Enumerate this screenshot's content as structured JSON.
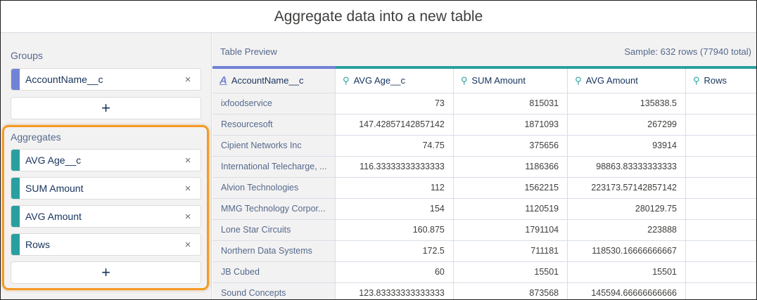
{
  "header": {
    "title": "Aggregate data into a new table"
  },
  "left": {
    "groups_label": "Groups",
    "groups": [
      {
        "label": "AccountName__c"
      }
    ],
    "aggregates_label": "Aggregates",
    "aggregates": [
      {
        "label": "AVG Age__c"
      },
      {
        "label": "SUM Amount"
      },
      {
        "label": "AVG Amount"
      },
      {
        "label": "Rows"
      }
    ],
    "add_symbol": "+",
    "remove_symbol": "×"
  },
  "preview": {
    "title": "Table Preview",
    "sample": "Sample: 632 rows (77940 total)",
    "columns": [
      {
        "label": "AccountName__c",
        "icon": "dimension-icon",
        "glyph": "A"
      },
      {
        "label": "AVG Age__c",
        "icon": "measure-icon",
        "glyph": "⚲"
      },
      {
        "label": "SUM Amount",
        "icon": "measure-icon",
        "glyph": "⚲"
      },
      {
        "label": "AVG Amount",
        "icon": "measure-icon",
        "glyph": "⚲"
      },
      {
        "label": "Rows",
        "icon": "measure-icon",
        "glyph": "⚲"
      }
    ],
    "rows": [
      [
        "ixfoodservice",
        "73",
        "815031",
        "135838.5",
        ""
      ],
      [
        "Resourcesoft",
        "147.42857142857142",
        "1871093",
        "267299",
        ""
      ],
      [
        "Cipient Networks Inc",
        "74.75",
        "375656",
        "93914",
        ""
      ],
      [
        "International Telecharge, ...",
        "116.33333333333333",
        "1186366",
        "98863.83333333333",
        ""
      ],
      [
        "Alvion Technologies",
        "112",
        "1562215",
        "223173.57142857142",
        ""
      ],
      [
        "MMG Technology Corpor...",
        "154",
        "1120519",
        "280129.75",
        ""
      ],
      [
        "Lone Star Circuits",
        "160.875",
        "1791104",
        "223888",
        ""
      ],
      [
        "Northern Data Systems",
        "172.5",
        "711181",
        "118530.16666666667",
        ""
      ],
      [
        "JB Cubed",
        "60",
        "15501",
        "15501",
        ""
      ],
      [
        "Sound Concepts",
        "123.83333333333333",
        "873568",
        "145594.66666666666",
        ""
      ]
    ]
  },
  "colors": {
    "group_accent": "#7282d6",
    "aggregate_accent": "#2a9fa0",
    "highlight": "#f59a23"
  }
}
